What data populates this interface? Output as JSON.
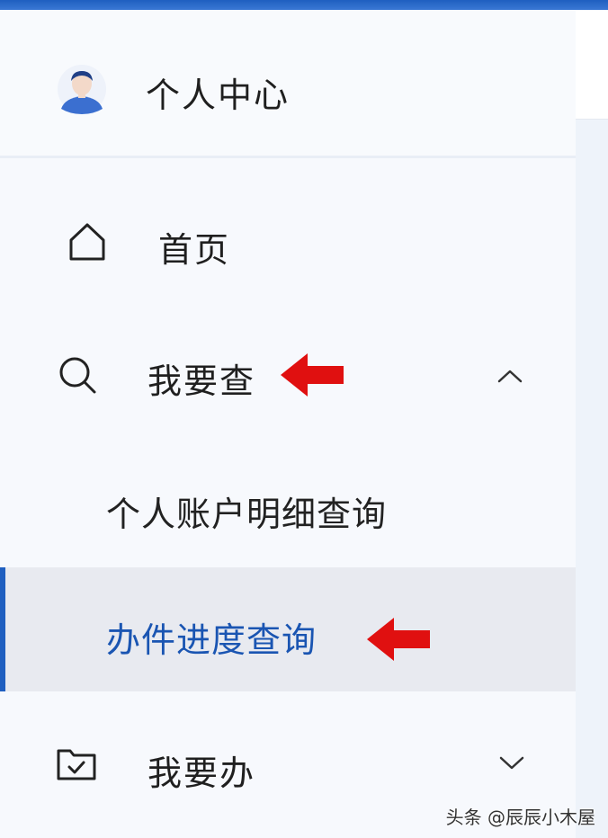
{
  "user": {
    "label": "个人中心"
  },
  "menu": {
    "home": {
      "label": "首页"
    },
    "query": {
      "label": "我要查",
      "expanded": true,
      "children": [
        {
          "label": "个人账户明细查询",
          "active": false
        },
        {
          "label": "办件进度查询",
          "active": true
        }
      ]
    },
    "handle": {
      "label": "我要办",
      "expanded": false
    }
  },
  "icons": {
    "user": "user-avatar-icon",
    "home": "home-icon",
    "query": "search-icon",
    "handle": "folder-check-icon",
    "expanded": "chevron-up-icon",
    "collapsed": "chevron-down-icon",
    "annotation": "red-arrow-icon"
  },
  "colors": {
    "accent": "#1f5fc0",
    "active_text": "#1a55b2",
    "active_bg": "#e8eaf0",
    "arrow": "#e01010"
  },
  "watermark": "头条 @辰辰小木屋"
}
